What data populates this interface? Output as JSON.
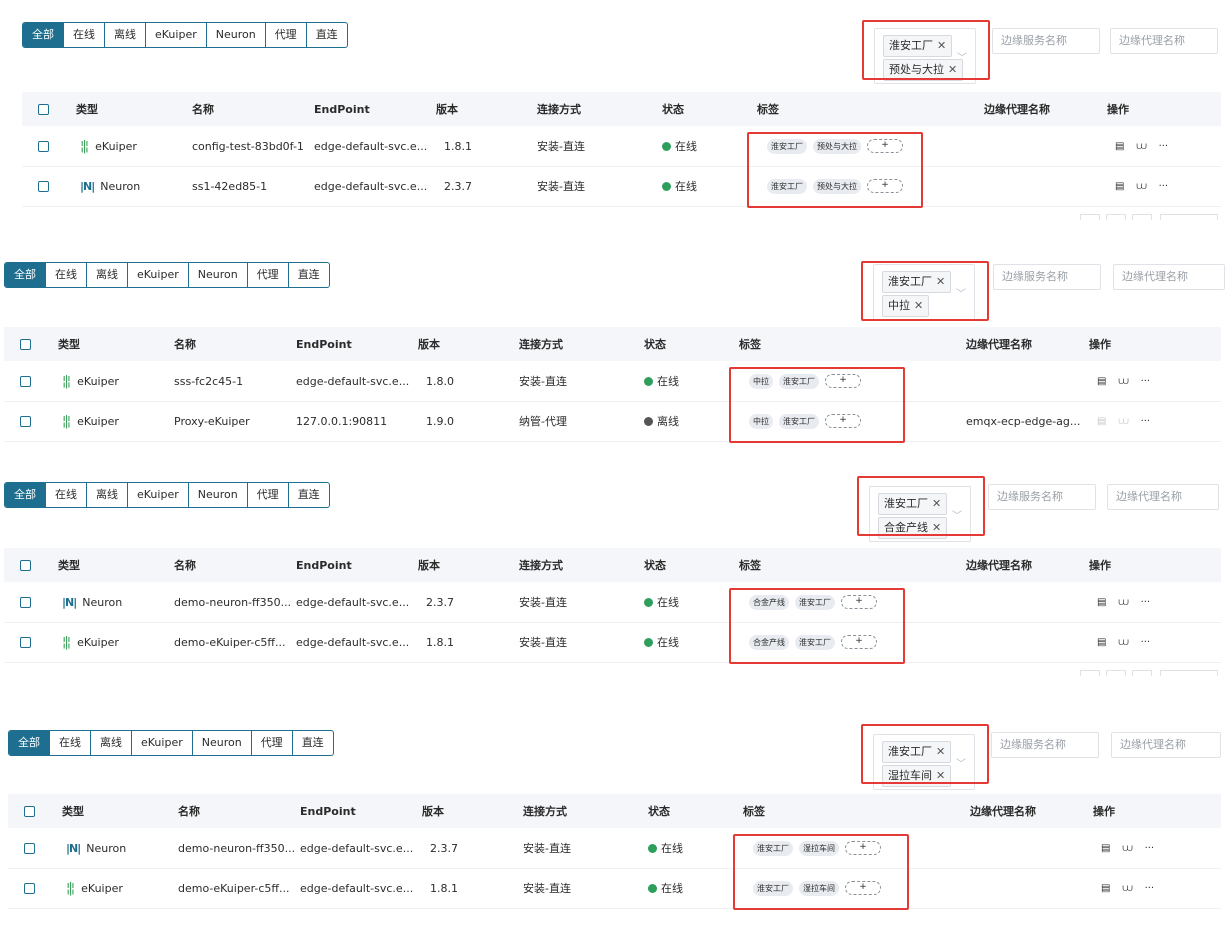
{
  "segments": [
    "全部",
    "在线",
    "离线",
    "eKuiper",
    "Neuron",
    "代理",
    "直连"
  ],
  "search_placeholders": {
    "service": "边缘服务名称",
    "proxy": "边缘代理名称"
  },
  "headers": [
    "类型",
    "名称",
    "EndPoint",
    "版本",
    "连接方式",
    "状态",
    "标签",
    "边缘代理名称",
    "操作"
  ],
  "icons": {
    "ekuiper": "ekuiper-logo-icon",
    "neuron": "neuron-logo-icon",
    "close": "close-icon",
    "chevron": "chevron-down-icon",
    "add": "plus-icon"
  },
  "colors": {
    "accent": "#1e6f8f",
    "online": "#2e9e5b",
    "offline": "#555555",
    "highlight": "#e53935"
  },
  "add_label": "+",
  "ops": {
    "detail": "▤",
    "config": "⩊",
    "more": "···"
  },
  "panels": [
    {
      "filter": [
        "淮安工厂",
        "预处与大拉"
      ],
      "rows": [
        {
          "type": "eKuiper",
          "name": "config-test-83bd0f-1",
          "endpoint": "edge-default-svc.e...",
          "version": "1.8.1",
          "connection": "安装-直连",
          "status": "在线",
          "online": true,
          "tags": [
            "淮安工厂",
            "预处与大拉"
          ],
          "proxy": ""
        },
        {
          "type": "Neuron",
          "name": "ss1-42ed85-1",
          "endpoint": "edge-default-svc.e...",
          "version": "2.3.7",
          "connection": "安装-直连",
          "status": "在线",
          "online": true,
          "tags": [
            "淮安工厂",
            "预处与大拉"
          ],
          "proxy": ""
        }
      ]
    },
    {
      "filter": [
        "淮安工厂",
        "中拉"
      ],
      "rows": [
        {
          "type": "eKuiper",
          "name": "sss-fc2c45-1",
          "endpoint": "edge-default-svc.e...",
          "version": "1.8.0",
          "connection": "安装-直连",
          "status": "在线",
          "online": true,
          "tags": [
            "中拉",
            "淮安工厂"
          ],
          "proxy": ""
        },
        {
          "type": "eKuiper",
          "name": "Proxy-eKuiper",
          "endpoint": "127.0.0.1:90811",
          "version": "1.9.0",
          "connection": "纳管-代理",
          "status": "离线",
          "online": false,
          "tags": [
            "中拉",
            "淮安工厂"
          ],
          "proxy": "emqx-ecp-edge-ag..."
        }
      ]
    },
    {
      "filter": [
        "淮安工厂",
        "合金产线"
      ],
      "rows": [
        {
          "type": "Neuron",
          "name": "demo-neuron-ff350...",
          "endpoint": "edge-default-svc.e...",
          "version": "2.3.7",
          "connection": "安装-直连",
          "status": "在线",
          "online": true,
          "tags": [
            "合金产线",
            "淮安工厂"
          ],
          "proxy": ""
        },
        {
          "type": "eKuiper",
          "name": "demo-eKuiper-c5ff...",
          "endpoint": "edge-default-svc.e...",
          "version": "1.8.1",
          "connection": "安装-直连",
          "status": "在线",
          "online": true,
          "tags": [
            "合金产线",
            "淮安工厂"
          ],
          "proxy": ""
        }
      ]
    },
    {
      "filter": [
        "淮安工厂",
        "湿拉车间"
      ],
      "rows": [
        {
          "type": "Neuron",
          "name": "demo-neuron-ff350...",
          "endpoint": "edge-default-svc.e...",
          "version": "2.3.7",
          "connection": "安装-直连",
          "status": "在线",
          "online": true,
          "tags": [
            "淮安工厂",
            "湿拉车间"
          ],
          "proxy": ""
        },
        {
          "type": "eKuiper",
          "name": "demo-eKuiper-c5ff...",
          "endpoint": "edge-default-svc.e...",
          "version": "1.8.1",
          "connection": "安装-直连",
          "status": "在线",
          "online": true,
          "tags": [
            "淮安工厂",
            "湿拉车间"
          ],
          "proxy": ""
        }
      ]
    }
  ]
}
